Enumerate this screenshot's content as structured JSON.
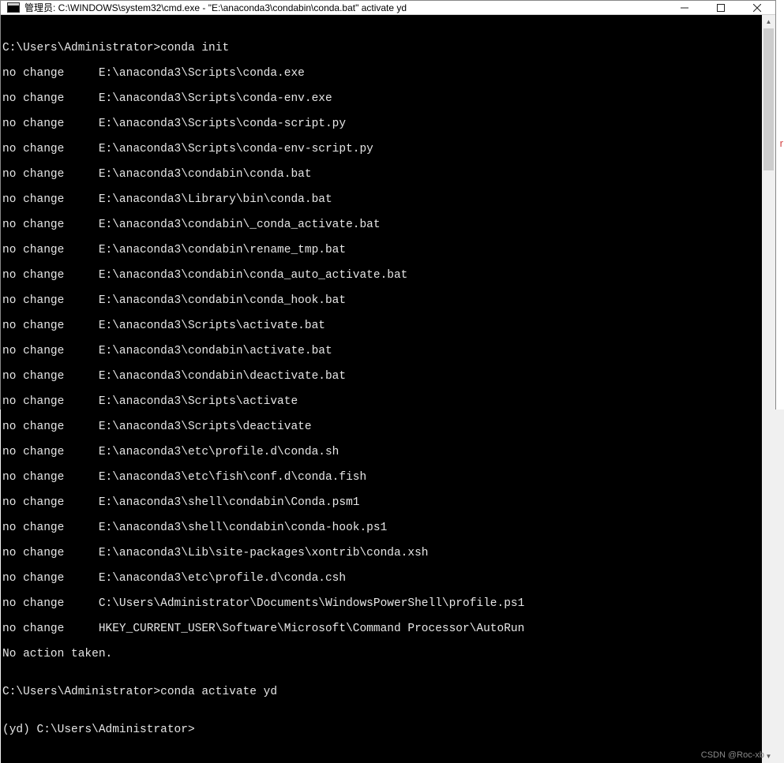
{
  "titlebar": {
    "title": "管理员: C:\\WINDOWS\\system32\\cmd.exe - \"E:\\anaconda3\\condabin\\conda.bat\"  activate yd"
  },
  "terminal": {
    "prompt1_path": "C:\\Users\\Administrator>",
    "prompt1_cmd": "conda init",
    "lines": [
      "no change     E:\\anaconda3\\Scripts\\conda.exe",
      "no change     E:\\anaconda3\\Scripts\\conda-env.exe",
      "no change     E:\\anaconda3\\Scripts\\conda-script.py",
      "no change     E:\\anaconda3\\Scripts\\conda-env-script.py",
      "no change     E:\\anaconda3\\condabin\\conda.bat",
      "no change     E:\\anaconda3\\Library\\bin\\conda.bat",
      "no change     E:\\anaconda3\\condabin\\_conda_activate.bat",
      "no change     E:\\anaconda3\\condabin\\rename_tmp.bat",
      "no change     E:\\anaconda3\\condabin\\conda_auto_activate.bat",
      "no change     E:\\anaconda3\\condabin\\conda_hook.bat",
      "no change     E:\\anaconda3\\Scripts\\activate.bat",
      "no change     E:\\anaconda3\\condabin\\activate.bat",
      "no change     E:\\anaconda3\\condabin\\deactivate.bat",
      "no change     E:\\anaconda3\\Scripts\\activate",
      "no change     E:\\anaconda3\\Scripts\\deactivate",
      "no change     E:\\anaconda3\\etc\\profile.d\\conda.sh",
      "no change     E:\\anaconda3\\etc\\fish\\conf.d\\conda.fish",
      "no change     E:\\anaconda3\\shell\\condabin\\Conda.psm1",
      "no change     E:\\anaconda3\\shell\\condabin\\conda-hook.ps1",
      "no change     E:\\anaconda3\\Lib\\site-packages\\xontrib\\conda.xsh",
      "no change     E:\\anaconda3\\etc\\profile.d\\conda.csh",
      "no change     C:\\Users\\Administrator\\Documents\\WindowsPowerShell\\profile.ps1",
      "no change     HKEY_CURRENT_USER\\Software\\Microsoft\\Command Processor\\AutoRun"
    ],
    "action_line": "No action taken.",
    "blank": "",
    "prompt2_path": "C:\\Users\\Administrator>",
    "prompt2_cmd": "conda activate yd",
    "prompt3": "(yd) C:\\Users\\Administrator>"
  },
  "watermark": "CSDN @Roc-xb",
  "right_accent": "r"
}
